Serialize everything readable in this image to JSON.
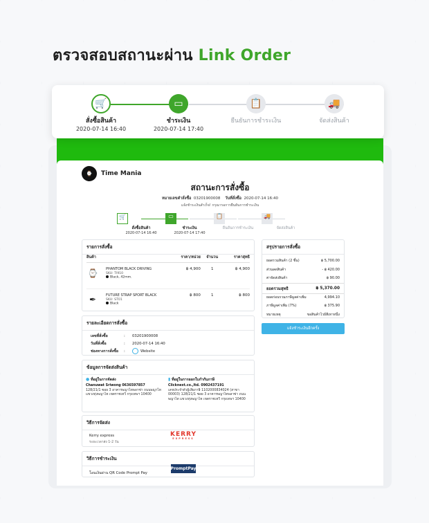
{
  "headline": {
    "prefix": "ตรวจสอบสถานะผ่าน",
    "accent": "Link Order"
  },
  "steps": [
    {
      "label": "สั่งซื้อสินค้า",
      "date": "2020-07-14  16:40",
      "state": "done",
      "icon": "cart-icon"
    },
    {
      "label": "ชำระเงิน",
      "date": "2020-07-14  17:40",
      "state": "active",
      "icon": "card-icon"
    },
    {
      "label": "ยืนยันการชำระเงิน",
      "date": "",
      "state": "todo",
      "icon": "clipboard-icon"
    },
    {
      "label": "จัดส่งสินค้า",
      "date": "",
      "state": "todo",
      "icon": "truck-icon"
    }
  ],
  "shop": {
    "name": "Time Mania",
    "logo_text": "TIME MANIA"
  },
  "status": {
    "title": "สถานะการสั่งซื้อ",
    "order_no_label": "หมายเลขคำสั่งซื้อ",
    "order_no": "03201900008",
    "order_date_label": "วันที่สั่งซื้อ",
    "order_date": "2020-07-14  16:40",
    "note": "แจ้งชำระเงินสำเร็จ! กรุณารอการยืนยันการชำระเงิน"
  },
  "inner_steps": [
    {
      "label": "สั่งซื้อสินค้า",
      "date": "2020-07-14  16:40"
    },
    {
      "label": "ชำระเงิน",
      "date": "2020-07-14  17:40"
    },
    {
      "label": "ยืนยันการชำระเงิน",
      "date": ""
    },
    {
      "label": "จัดส่งสินค้า",
      "date": ""
    }
  ],
  "order_list": {
    "title": "รายการสั่งซื้อ",
    "headers": [
      "สินค้า",
      "ราคา/หน่วย",
      "จำนวน",
      "ราคาสุทธิ"
    ],
    "items": [
      {
        "name": "PHANTOM BLACK DRIVING",
        "sku": "SKU: TI910",
        "variant": "Black, 42mm.",
        "price": "฿ 4,900",
        "qty": "1",
        "total": "฿ 4,900"
      },
      {
        "name": "FUTURE STRAP SPORT BLACK",
        "sku": "SKU: ST01",
        "variant": "Black",
        "price": "฿ 800",
        "qty": "1",
        "total": "฿ 800"
      }
    ]
  },
  "order_detail": {
    "title": "รายละเอียดการสั่งซื้อ",
    "rows": [
      {
        "k": "เลขที่สั่งซื้อ",
        "v": "03201900008"
      },
      {
        "k": "วันที่สั่งซื้อ",
        "v": "2020-07-14  16:40"
      },
      {
        "k": "ช่องทางการสั่งซื้อ",
        "v": "Website"
      }
    ]
  },
  "shipping_info": {
    "title": "ข้อมูลการจัดส่งสินค้า",
    "ship_head": "ที่อยู่ในการจัดส่ง",
    "ship_name": "Chanuwat Sriwong 0636597857",
    "ship_addr": "128/21/1 ซอย 3 อาคารพญาไทพลาซ่า ถนนพญาไท แขวงทุ่งพญาไท เขตราชเทวี กรุงเทพฯ 10400",
    "tax_head": "ที่อยู่ในการออกใบกำกับภาษี",
    "tax_name": "Clicknext.co.,ltd.  0902437191",
    "tax_addr": "เลขประจำตัวผู้เสียภาษี 1102000834024 (สาขา 00003) 128/21/1 ซอย 3 อาคารพญาไทพลาซ่า ถนนพญาไท แขวงทุ่งพญาไท เขตราชเทวี กรุงเทพฯ 10400"
  },
  "shipping_method": {
    "title": "วิธีการจัดส่ง",
    "name": "Kerry express",
    "eta": "ระยะเวลาส่ง  1-2  วัน",
    "logo": "KERRY",
    "logo_sub": "EXPRESS"
  },
  "payment_method": {
    "title": "วิธีการชำระเงิน",
    "name": "โอนเงินผ่าน QR Code Prompt Pay",
    "logo": "PromptPay"
  },
  "summary": {
    "title": "สรุปรายการสั่งซื้อ",
    "rows": [
      {
        "k": "ยอดรวมสินค้า (2 ชิ้น)",
        "v": "฿ 5,700.00"
      },
      {
        "k": "ส่วนลดสินค้า",
        "v": "- ฿ 420.00"
      },
      {
        "k": "ค่าจัดส่งสินค้า",
        "v": "฿ 90.00"
      }
    ],
    "net_label": "ยอดรวมสุทธิ",
    "net_value": "฿ 5,370.00",
    "tax_rows": [
      {
        "k": "ยอดก่อนรวมภาษีมูลค่าเพิ่ม",
        "v": "4,994.10"
      },
      {
        "k": "ภาษีมูลค่าเพิ่ม (7%)",
        "v": "฿ 375.90"
      },
      {
        "k": "หมายเหตุ",
        "v": "ขอสินค้าไวย์สีเทาหนึ่ง"
      }
    ],
    "button": "แจ้งชำระเงินอีกครั้ง"
  },
  "colors": {
    "accent": "#3fa62b",
    "band": "#1fba0e",
    "link": "#3fb3e6",
    "kerry": "#e2372c"
  }
}
